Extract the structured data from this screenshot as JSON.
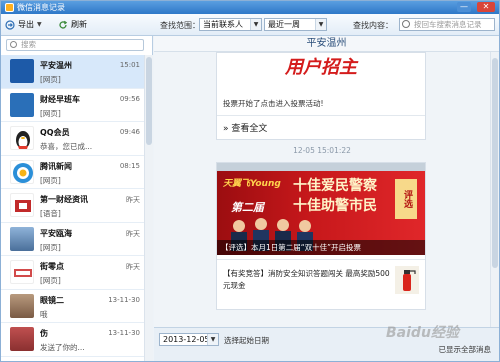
{
  "window": {
    "title": "微信消息记录"
  },
  "toolbar": {
    "export_label": "导出",
    "refresh_label": "刷新",
    "range_label": "查找范围：",
    "contact_value": "当前联系人",
    "period_value": "最近一周",
    "find_label": "查找内容：",
    "find_placeholder": "按回车搜索消息记录"
  },
  "left": {
    "search_placeholder": "搜索",
    "items": [
      {
        "name": "平安温州",
        "preview": "[网页]",
        "time": "15:01",
        "color": "#1d5aa8"
      },
      {
        "name": "财经早班车",
        "preview": "[网页]",
        "time": "09:56",
        "color": "#2a6fb8"
      },
      {
        "name": "QQ会员",
        "preview": "恭喜，您已成...",
        "time": "09:46",
        "color": "#e23b2e"
      },
      {
        "name": "腾讯新闻",
        "preview": "[网页]",
        "time": "08:15",
        "color": "#2b8fd8"
      },
      {
        "name": "第一财经资讯",
        "preview": "[语音]",
        "time": "昨天",
        "color": "#c22a2a"
      },
      {
        "name": "平安瓯海",
        "preview": "[网页]",
        "time": "昨天",
        "color": "#4a6f9a"
      },
      {
        "name": "街零点",
        "preview": "[网页]",
        "time": "昨天",
        "color": "#d24a4a"
      },
      {
        "name": "眼镜二",
        "preview": "哦",
        "time": "13-11-30",
        "color": "#7a5a44"
      },
      {
        "name": "伤",
        "preview": "发送了你的...",
        "time": "13-11-30",
        "color": "#8a3030"
      }
    ]
  },
  "chat": {
    "header": "平安温州",
    "card1": {
      "banner_text": "用户招主",
      "desc": "投票开始了点击进入投票活动!",
      "readmore": "» 查看全文"
    },
    "timestamp": "12-05 15:01:22",
    "card2": {
      "brand": "天翼飞Young",
      "period": "第二届",
      "slogan1": "十佳爱民警察",
      "slogan2": "十佳助警市民",
      "badge": "评选",
      "caption": "【评选】本月1日第二届“双十佳”开启投票",
      "news_text": "【有奖竞答】消防安全知识答题闯关  最高奖励500元现金"
    }
  },
  "bottom": {
    "date_value": "2013-12-05",
    "date_hint": "选择起始日期",
    "watermark": "Baidu经验",
    "status": "已显示全部消息"
  },
  "colors": {
    "accent": "#2e78c8",
    "selected_row": "#d7e8fa"
  }
}
